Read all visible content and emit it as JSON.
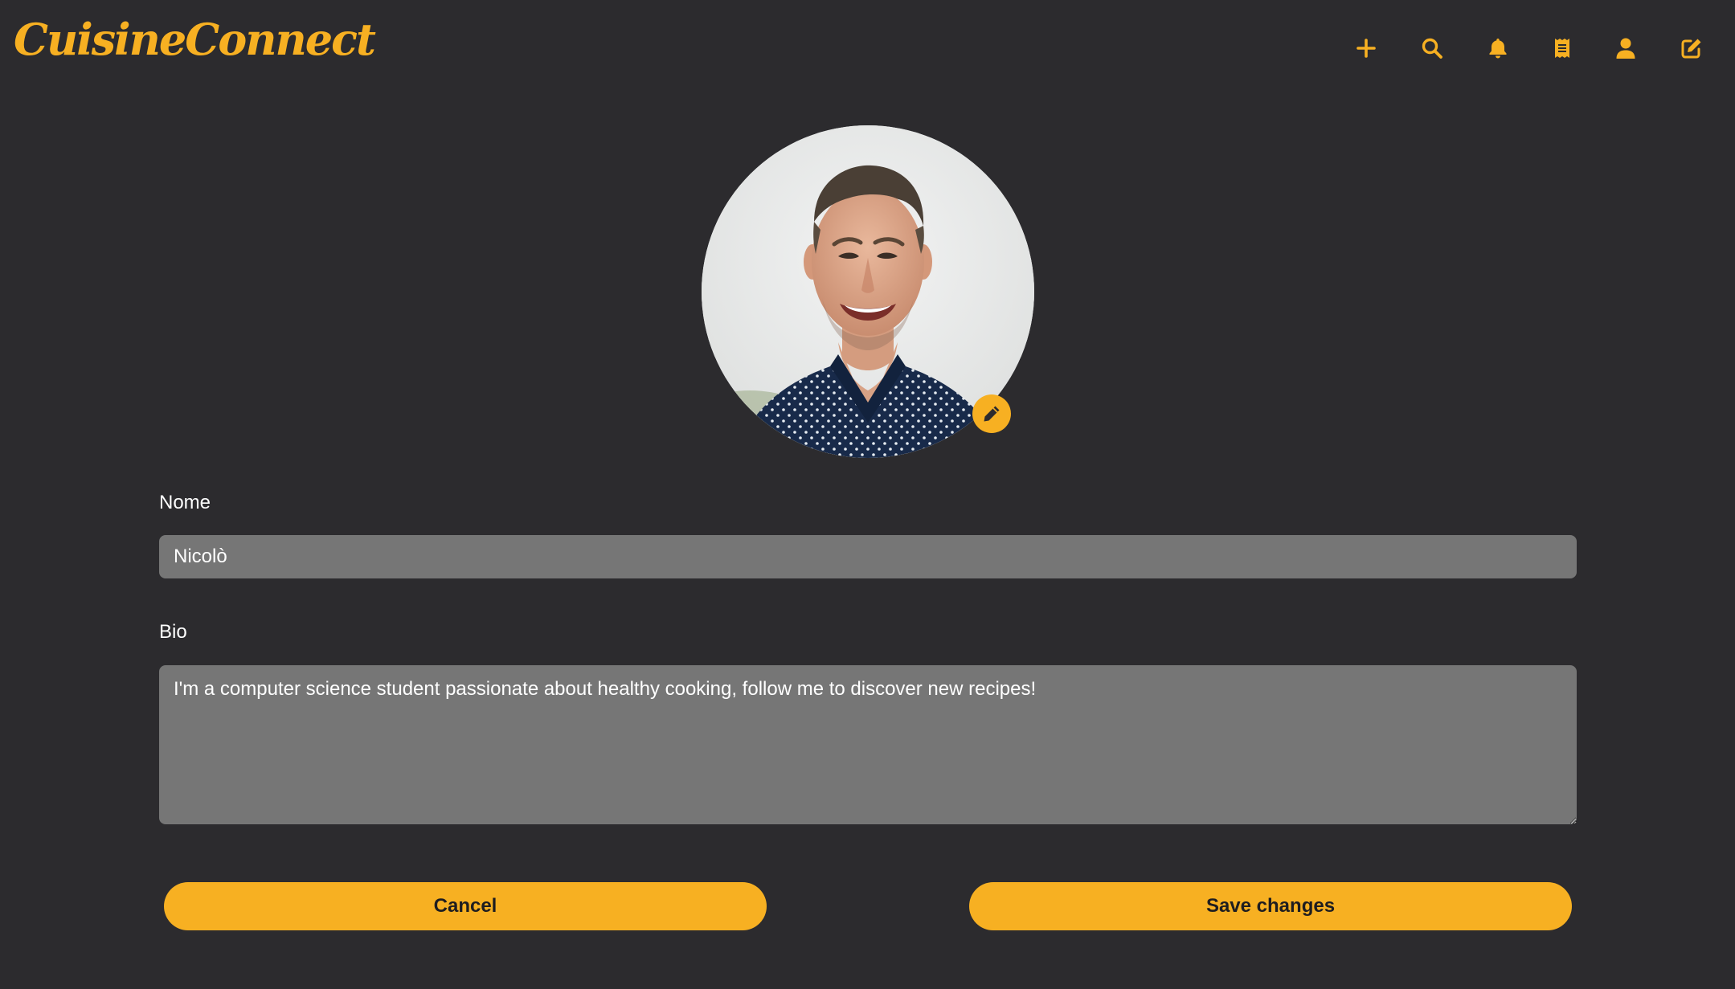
{
  "app": {
    "logo_text": "CuisineConnect",
    "accent_color": "#f7b022",
    "background_color": "#2c2b2e"
  },
  "header": {
    "icons": [
      {
        "name": "plus-icon",
        "label": "Add"
      },
      {
        "name": "search-icon",
        "label": "Search"
      },
      {
        "name": "bell-icon",
        "label": "Notifications"
      },
      {
        "name": "receipt-icon",
        "label": "Recipes"
      },
      {
        "name": "user-icon",
        "label": "Profile"
      },
      {
        "name": "edit-icon",
        "label": "Edit profile"
      }
    ]
  },
  "profile": {
    "avatar_icon": "pencil-icon"
  },
  "form": {
    "name_label": "Nome",
    "name_value": "Nicolò",
    "bio_label": "Bio",
    "bio_value": "I'm a computer science student passionate about healthy cooking, follow me to discover new recipes!"
  },
  "actions": {
    "cancel_label": "Cancel",
    "save_label": "Save changes"
  }
}
